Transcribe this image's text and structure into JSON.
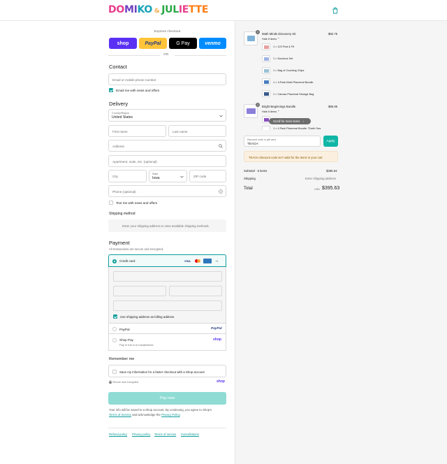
{
  "header": {
    "logo_text": "DOMIKO & JULIETTE",
    "cart_icon": "shopping-bag-icon"
  },
  "express": {
    "label": "Express checkout",
    "buttons": [
      {
        "name": "shop",
        "label": "shop",
        "color": "#5a31f4"
      },
      {
        "name": "paypal",
        "label": "PayPal",
        "color": "#ffc439"
      },
      {
        "name": "gpay",
        "label": "G Pay",
        "color": "#000000"
      },
      {
        "name": "venmo",
        "label": "venmo",
        "color": "#008cff"
      }
    ],
    "or": "OR"
  },
  "contact": {
    "heading": "Contact",
    "phone_placeholder": "Email or mobile phone number",
    "news_label": "Email me with news and offers"
  },
  "delivery": {
    "heading": "Delivery",
    "country_label": "Country/Region",
    "country_value": "United States",
    "first_name": "First name",
    "last_name": "Last name",
    "address": "Address",
    "apartment": "Apartment, suite, etc. (optional)",
    "city": "City",
    "state_label": "State",
    "state_value": "Iowa",
    "zip": "ZIP code",
    "phone": "Phone (optional)",
    "text_label": "Text me with news and offers"
  },
  "shipping": {
    "heading": "Shipping method",
    "note": "Enter your shipping address to view available shipping methods."
  },
  "payment": {
    "heading": "Payment",
    "sub": "All transactions are secure and encrypted.",
    "credit_card": "Credit card",
    "card_brands": [
      "VISA",
      "MC",
      "AMEX",
      "+5"
    ],
    "billing_label": "Use shipping address as billing address",
    "paypal": "PayPal",
    "paypal_logo": "PayPal",
    "shop_pay": "Shop Pay",
    "shop_pay_sub": "Pay in full or in installments",
    "shop_logo": "shop"
  },
  "remember": {
    "heading": "Remember me",
    "save_label": "Save my information for a faster checkout with a Shop account",
    "secure": "Secure and encrypted",
    "shop_logo": "shop"
  },
  "pay_now": "Pay now",
  "legal": {
    "line1": "Your info will be saved to a Shop account. By continuing, you agree to Shop's",
    "terms": "Terms of Service",
    "and": " and acknowledge the ",
    "privacy": "Privacy Policy",
    "end": "."
  },
  "footer": [
    "Refund policy",
    "Privacy policy",
    "Terms of service",
    "Cancellations"
  ],
  "summary": {
    "items": [
      {
        "qty": "1",
        "name": "Math Minds Discovery Kit",
        "price": "$92.75",
        "toggle": "Hide 5 items",
        "sub": [
          "1 × 123 Find & Fit",
          "1 × Dominos Set",
          "1 × Bag of Counting Chips",
          "1 × 3-Pack Math Placemat Bundle",
          "1 × Canvas Placemat Storage Bag"
        ]
      },
      {
        "qty": "1",
        "name": "Bright Beginnings Bundle",
        "price": "$95.95",
        "toggle": "Hide 5 items",
        "sub": [
          "",
          "1 × 4 Pack Placemat Bundle: \"Earth Sea"
        ]
      }
    ],
    "tooltip": "Scroll for more items",
    "discount_label": "Discount code or gift card",
    "discount_value": "TEACH",
    "apply": "Apply",
    "warning": "TEACH discount code isn't valid for the items in your cart",
    "subtotal_label": "Subtotal · 5 items",
    "subtotal_value": "$395.63",
    "shipping_label": "Shipping",
    "shipping_value": "Enter shipping address",
    "total_label": "Total",
    "currency": "USD",
    "total_value": "$395.63"
  }
}
